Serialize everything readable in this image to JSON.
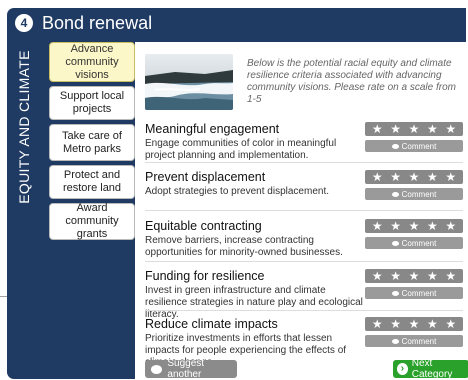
{
  "header": {
    "step_number": "4",
    "title": "Bond renewal"
  },
  "side_label": "EQUITY AND CLIMATE",
  "tabs": [
    {
      "label": "Advance community visions",
      "active": true
    },
    {
      "label": "Support local projects",
      "active": false
    },
    {
      "label": "Take care of Metro parks",
      "active": false
    },
    {
      "label": "Protect and restore land",
      "active": false
    },
    {
      "label": "Award community grants",
      "active": false
    }
  ],
  "intro_text": "Below is the potential racial equity and climate resilience criteria associated with advancing community visions. Please rate on a scale from 1-5",
  "criteria": [
    {
      "title": "Meaningful engagement",
      "description": "Engage communities of color in meaningful project planning and implementation.",
      "comment_label": "Comment"
    },
    {
      "title": "Prevent displacement",
      "description": "Adopt strategies to prevent displacement.",
      "comment_label": "Comment"
    },
    {
      "title": "Equitable contracting",
      "description": "Remove barriers, increase contracting opportunities for minority-owned businesses.",
      "comment_label": "Comment"
    },
    {
      "title": "Funding for resilience",
      "description": "Invest in green infrastructure and climate resilience strategies in nature play and ecological literacy.",
      "comment_label": "Comment"
    },
    {
      "title": "Reduce climate impacts",
      "description": "Prioritize investments in efforts that lessen impacts for people experiencing the effects of climate change.",
      "comment_label": "Comment"
    }
  ],
  "star_glyph": "★",
  "buttons": {
    "suggest": "Suggest another",
    "next": "Next Category"
  },
  "colors": {
    "header_bg": "#1f3a63",
    "active_tab": "#fbf7c8",
    "next_button": "#2aa12a",
    "rating_bar": "#888888"
  },
  "icons": {
    "comment": "speech-bubble-icon",
    "next": "arrow-right-circle-icon"
  }
}
